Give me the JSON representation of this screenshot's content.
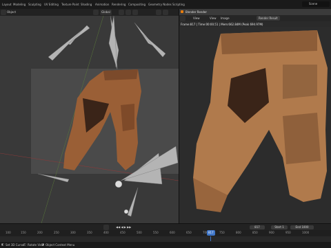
{
  "topbar": {
    "tabs": [
      "Layout",
      "Modeling",
      "Sculpting",
      "UV Editing",
      "Texture Paint",
      "Shading",
      "Animation",
      "Rendering",
      "Compositing",
      "Geometry Nodes",
      "Scripting"
    ],
    "active_tab": "Layout",
    "scene_label": "Scene"
  },
  "viewport": {
    "header": {
      "mode": "Object",
      "transform": "Global"
    }
  },
  "render_window": {
    "title": "Blender Render",
    "menu": [
      "View",
      "View",
      "Image"
    ],
    "slot": "Render Result",
    "stats": "Frame:817 | Time:00:00.51 | Mem:662.84M (Peak 694.97M)"
  },
  "timeline": {
    "current_frame": "817",
    "start_label": "Start",
    "start_value": "1",
    "end_label": "End",
    "end_value": "1000",
    "ticks": [
      "100",
      "150",
      "200",
      "250",
      "300",
      "350",
      "400",
      "450",
      "500",
      "550",
      "600",
      "650",
      "700",
      "750",
      "800",
      "817",
      "850",
      "900",
      "950",
      "1000"
    ],
    "playhead_fraction": 0.817
  },
  "statusbar": {
    "left": "Set 3D Cursor",
    "middle": "Rotate View",
    "context": "Object Context Menu"
  },
  "colors": {
    "pants": "#9a5f36",
    "pants_dark": "#3a2418",
    "render_pants": "#b07a4c",
    "accent": "#4772b3",
    "playhead": "#3f76c9"
  }
}
